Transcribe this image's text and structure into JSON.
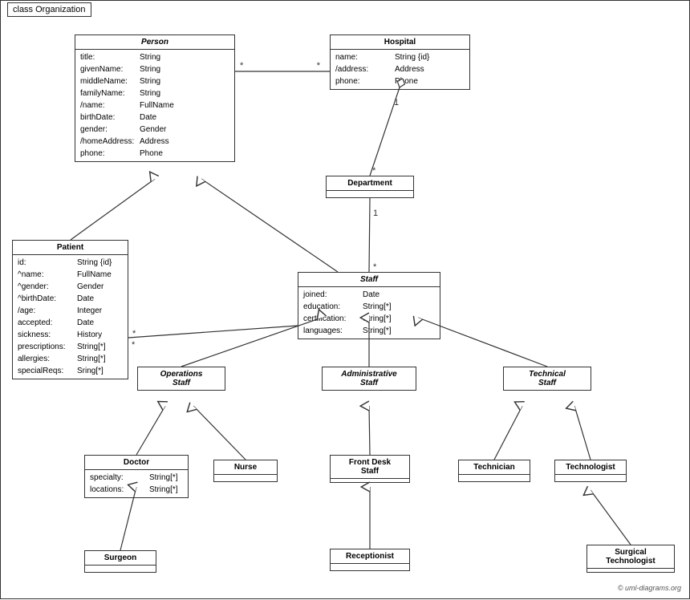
{
  "diagram": {
    "title": "class Organization",
    "copyright": "© uml-diagrams.org",
    "classes": {
      "person": {
        "name": "Person",
        "italic": true,
        "attrs": [
          {
            "name": "title:",
            "type": "String"
          },
          {
            "name": "givenName:",
            "type": "String"
          },
          {
            "name": "middleName:",
            "type": "String"
          },
          {
            "name": "familyName:",
            "type": "String"
          },
          {
            "name": "/name:",
            "type": "FullName"
          },
          {
            "name": "birthDate:",
            "type": "Date"
          },
          {
            "name": "gender:",
            "type": "Gender"
          },
          {
            "name": "/homeAddress:",
            "type": "Address"
          },
          {
            "name": "phone:",
            "type": "Phone"
          }
        ]
      },
      "hospital": {
        "name": "Hospital",
        "italic": false,
        "attrs": [
          {
            "name": "name:",
            "type": "String {id}"
          },
          {
            "name": "/address:",
            "type": "Address"
          },
          {
            "name": "phone:",
            "type": "Phone"
          }
        ]
      },
      "department": {
        "name": "Department",
        "italic": false,
        "attrs": []
      },
      "staff": {
        "name": "Staff",
        "italic": true,
        "attrs": [
          {
            "name": "joined:",
            "type": "Date"
          },
          {
            "name": "education:",
            "type": "String[*]"
          },
          {
            "name": "certification:",
            "type": "String[*]"
          },
          {
            "name": "languages:",
            "type": "String[*]"
          }
        ]
      },
      "patient": {
        "name": "Patient",
        "italic": false,
        "attrs": [
          {
            "name": "id:",
            "type": "String {id}"
          },
          {
            "name": "^name:",
            "type": "FullName"
          },
          {
            "name": "^gender:",
            "type": "Gender"
          },
          {
            "name": "^birthDate:",
            "type": "Date"
          },
          {
            "name": "/age:",
            "type": "Integer"
          },
          {
            "name": "accepted:",
            "type": "Date"
          },
          {
            "name": "sickness:",
            "type": "History"
          },
          {
            "name": "prescriptions:",
            "type": "String[*]"
          },
          {
            "name": "allergies:",
            "type": "String[*]"
          },
          {
            "name": "specialReqs:",
            "type": "Sring[*]"
          }
        ]
      },
      "operations_staff": {
        "name": "Operations Staff",
        "italic": true
      },
      "admin_staff": {
        "name": "Administrative Staff",
        "italic": true
      },
      "technical_staff": {
        "name": "Technical Staff",
        "italic": true
      },
      "doctor": {
        "name": "Doctor",
        "italic": false,
        "attrs": [
          {
            "name": "specialty:",
            "type": "String[*]"
          },
          {
            "name": "locations:",
            "type": "String[*]"
          }
        ]
      },
      "nurse": {
        "name": "Nurse",
        "italic": false,
        "attrs": []
      },
      "front_desk": {
        "name": "Front Desk Staff",
        "italic": false,
        "attrs": []
      },
      "technician": {
        "name": "Technician",
        "italic": false,
        "attrs": []
      },
      "technologist": {
        "name": "Technologist",
        "italic": false,
        "attrs": []
      },
      "surgeon": {
        "name": "Surgeon",
        "italic": false,
        "attrs": []
      },
      "receptionist": {
        "name": "Receptionist",
        "italic": false,
        "attrs": []
      },
      "surgical_technologist": {
        "name": "Surgical Technologist",
        "italic": false,
        "attrs": []
      }
    }
  }
}
